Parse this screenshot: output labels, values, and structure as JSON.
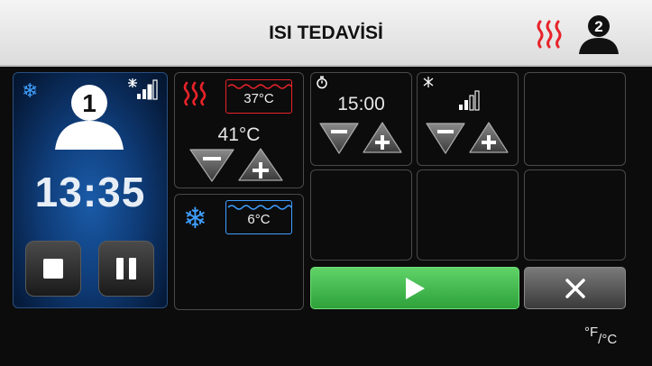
{
  "header": {
    "title": "ISI TEDAVİSİ",
    "heat_icon": "heat-waves-icon",
    "user_badge": "2",
    "heat_color": "#e8232a"
  },
  "user_panel": {
    "user_number": "1",
    "timer": "13:35",
    "icons": [
      "snowflake-icon",
      "cooling-intensity-icon",
      "stop-icon",
      "pause-icon"
    ],
    "panel_color": "#0f3c78"
  },
  "heat_cell": {
    "target_temp": "37°C",
    "current_temp": "41°C"
  },
  "cold_cell": {
    "target_temp": "6°C"
  },
  "time_cell": {
    "value": "15:00",
    "icon": "timer-icon"
  },
  "intensity_cell": {
    "icon": "cooling-intensity-icon"
  },
  "controls": {
    "start_color": "#3cb648",
    "unit_f": "°F",
    "unit_c": "/°C"
  }
}
